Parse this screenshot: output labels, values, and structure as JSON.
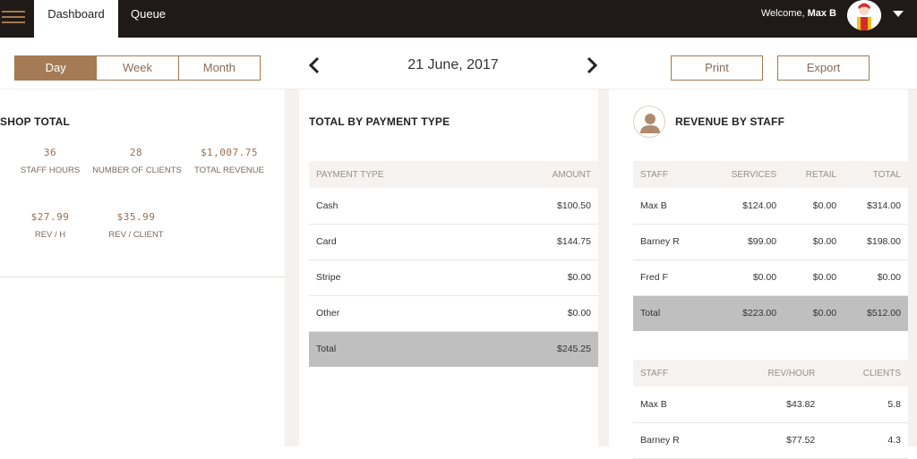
{
  "nav": {
    "tabs": [
      "Dashboard",
      "Queue"
    ],
    "welcome_prefix": "Welcome,",
    "user_name": "Max B"
  },
  "toolbar": {
    "ranges": [
      "Day",
      "Week",
      "Month"
    ],
    "active_range": "Day",
    "date": "21 June, 2017",
    "print_label": "Print",
    "export_label": "Export"
  },
  "shop_total": {
    "title": "SHOP TOTAL",
    "stats": [
      {
        "value": "36",
        "label": "STAFF HOURS"
      },
      {
        "value": "28",
        "label": "NUMBER OF CLIENTS"
      },
      {
        "value": "$1,007.75",
        "label": "TOTAL REVENUE"
      },
      {
        "value": "$27.99",
        "label": "REV / H"
      },
      {
        "value": "$35.99",
        "label": "REV / CLIENT"
      }
    ]
  },
  "payment": {
    "title": "TOTAL BY PAYMENT TYPE",
    "headers": [
      "PAYMENT TYPE",
      "AMOUNT"
    ],
    "rows": [
      [
        "Cash",
        "$100.50"
      ],
      [
        "Card",
        "$144.75"
      ],
      [
        "Stripe",
        "$0.00"
      ],
      [
        "Other",
        "$0.00"
      ]
    ],
    "total": [
      "Total",
      "$245.25"
    ]
  },
  "staff_revenue": {
    "title": "REVENUE BY STAFF",
    "headers": [
      "STAFF",
      "SERVICES",
      "RETAIL",
      "TOTAL"
    ],
    "rows": [
      [
        "Max B",
        "$124.00",
        "$0.00",
        "$314.00"
      ],
      [
        "Barney R",
        "$99.00",
        "$0.00",
        "$198.00"
      ],
      [
        "Fred F",
        "$0.00",
        "$0.00",
        "$0.00"
      ]
    ],
    "total": [
      "Total",
      "$223.00",
      "$0.00",
      "$512.00"
    ]
  },
  "staff_rates": {
    "headers": [
      "STAFF",
      "REV/HOUR",
      "CLIENTS"
    ],
    "rows": [
      [
        "Max B",
        "$43.82",
        "5.8"
      ],
      [
        "Barney R",
        "$77.52",
        "4.3"
      ]
    ]
  },
  "colors": {
    "nav_bg": "#1f1a17",
    "accent": "#a57b56",
    "total_row": "#bfbfbf"
  }
}
